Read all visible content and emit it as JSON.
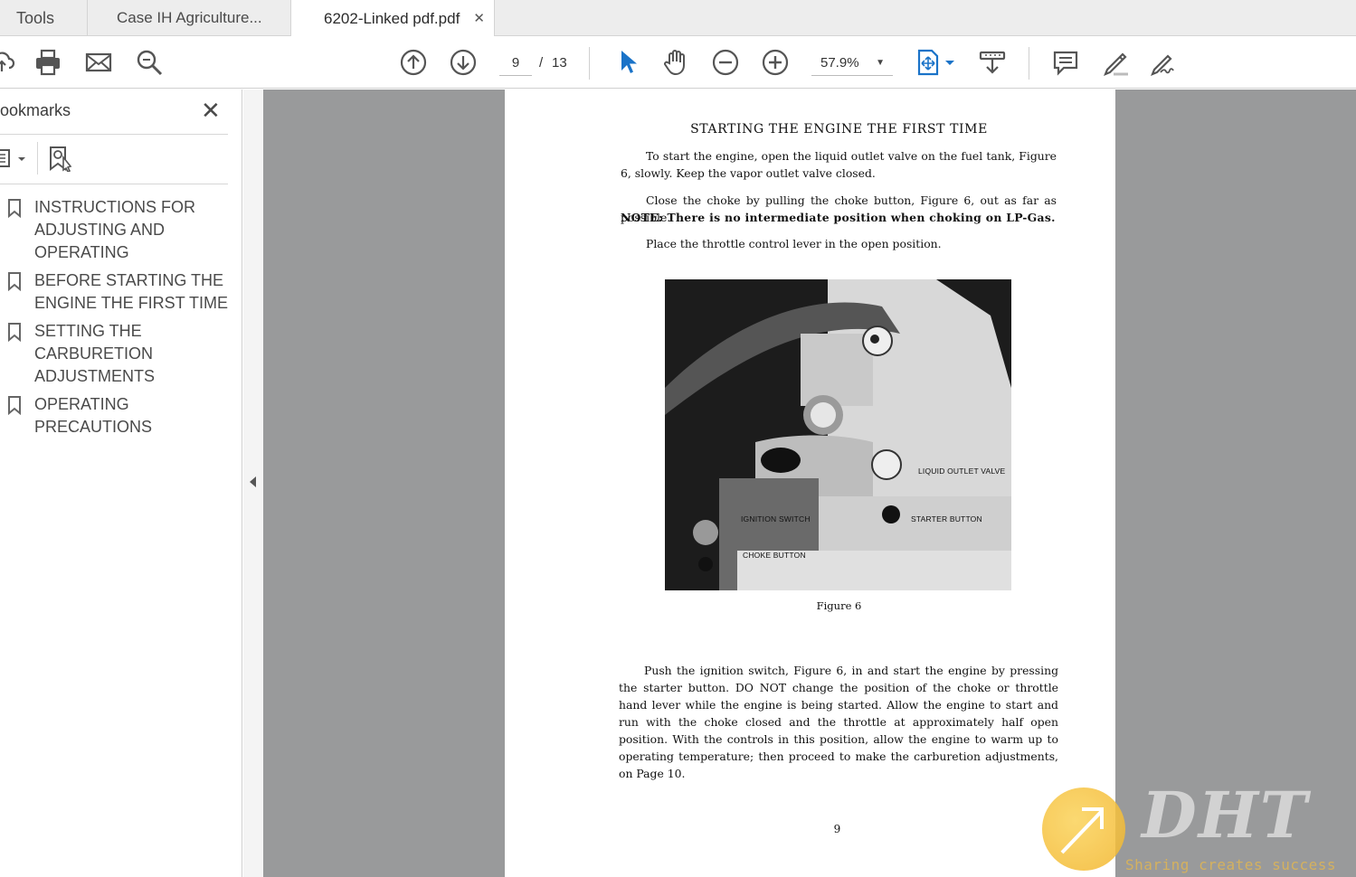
{
  "tabs": [
    {
      "label": "Tools"
    },
    {
      "label": "Case IH Agriculture..."
    },
    {
      "label": "6202-Linked pdf.pdf",
      "close": "✕"
    }
  ],
  "toolbar": {
    "page_current": "9",
    "page_separator": "/",
    "page_total": "13",
    "zoom": "57.9%",
    "accent_color": "#1a73c8"
  },
  "sidebar": {
    "title": "ookmarks",
    "close": "✕",
    "bookmarks": [
      {
        "label": "INSTRUCTIONS FOR ADJUSTING AND OPERATING"
      },
      {
        "label": "BEFORE STARTING THE ENGINE THE FIRST TIME"
      },
      {
        "label": "SETTING THE CARBURETION ADJUSTMENTS"
      },
      {
        "label": "OPERATING PRECAUTIONS"
      }
    ]
  },
  "document": {
    "title": "STARTING THE ENGINE THE FIRST TIME",
    "para1": "To start the engine, open the liquid outlet valve on the fuel tank, Figure 6, slowly. Keep the vapor outlet valve closed.",
    "para2": "Close the choke by pulling the choke button, Figure 6, out as far as possible.",
    "note": "NOTE: There is no intermediate position when choking on LP-Gas.",
    "para3": "Place the throttle control lever in the open position.",
    "figure_labels": {
      "liquid_outlet": "LIQUID OUTLET VALVE",
      "ignition": "IGNITION SWITCH",
      "starter": "STARTER BUTTON",
      "choke": "CHOKE BUTTON"
    },
    "figure_caption": "Figure 6",
    "para4": "Push the ignition switch, Figure 6, in and start the engine by pressing the starter button. DO NOT change the position of the choke or throttle hand lever while the engine is being started. Allow the engine to start and run with the choke closed and the throttle at approximately half open position. With the controls in this position, allow the engine to warm up to operating temperature; then proceed to make the carburetion adjustments, on Page 10.",
    "page_number": "9"
  },
  "watermark": {
    "brand": "DHT",
    "tagline": "Sharing creates success"
  }
}
